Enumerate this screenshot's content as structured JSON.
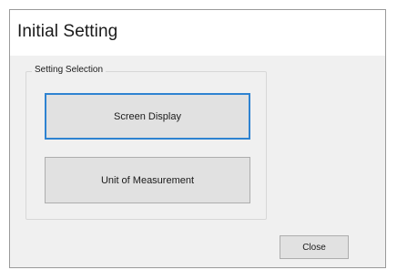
{
  "window": {
    "title": "Initial Setting"
  },
  "setting_group": {
    "legend": "Setting Selection",
    "buttons": [
      {
        "label": "Screen Display"
      },
      {
        "label": "Unit of Measurement"
      }
    ]
  },
  "footer": {
    "close_label": "Close"
  },
  "colors": {
    "focus_border": "#2e83d1",
    "button_face": "#e1e1e1",
    "dialog_background": "#f0f0f0"
  }
}
